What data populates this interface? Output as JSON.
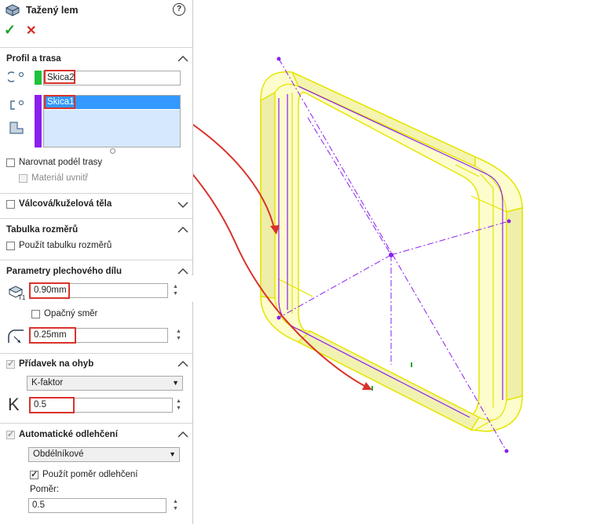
{
  "feature": {
    "title": "Tažený lem",
    "help": "?"
  },
  "actions": {
    "ok": "✓",
    "cancel": "✕"
  },
  "profile_section": {
    "header": "Profil a trasa",
    "profile_value": "Skica2",
    "path_value": "Skica1",
    "bend_along_path": "Narovnat podél trasy",
    "material_inside": "Materiál uvnitř"
  },
  "cyl_section": {
    "header": "Válcová/kuželová těla"
  },
  "table_section": {
    "header": "Tabulka rozměrů",
    "use_table": "Použít tabulku rozměrů"
  },
  "sheet_params": {
    "header": "Parametry plechového dílu",
    "thickness": "0.90mm",
    "reverse": "Opačný směr",
    "radius": "0.25mm"
  },
  "bend_allowance": {
    "header": "Přídavek na ohyb",
    "type": "K-faktor",
    "k_symbol": "K",
    "k_value": "0.5"
  },
  "relief": {
    "header": "Automatické odlehčení",
    "type": "Obdélníkové",
    "use_ratio": "Použít poměr odlehčení",
    "ratio_label": "Poměr:",
    "ratio_value": "0.5"
  },
  "colors": {
    "accent_green": "#1ec23b",
    "accent_purple": "#8b1ff0",
    "selection_blue": "#3399ff",
    "callout_red": "#d9322b",
    "model_yellow": "#ffff33"
  }
}
